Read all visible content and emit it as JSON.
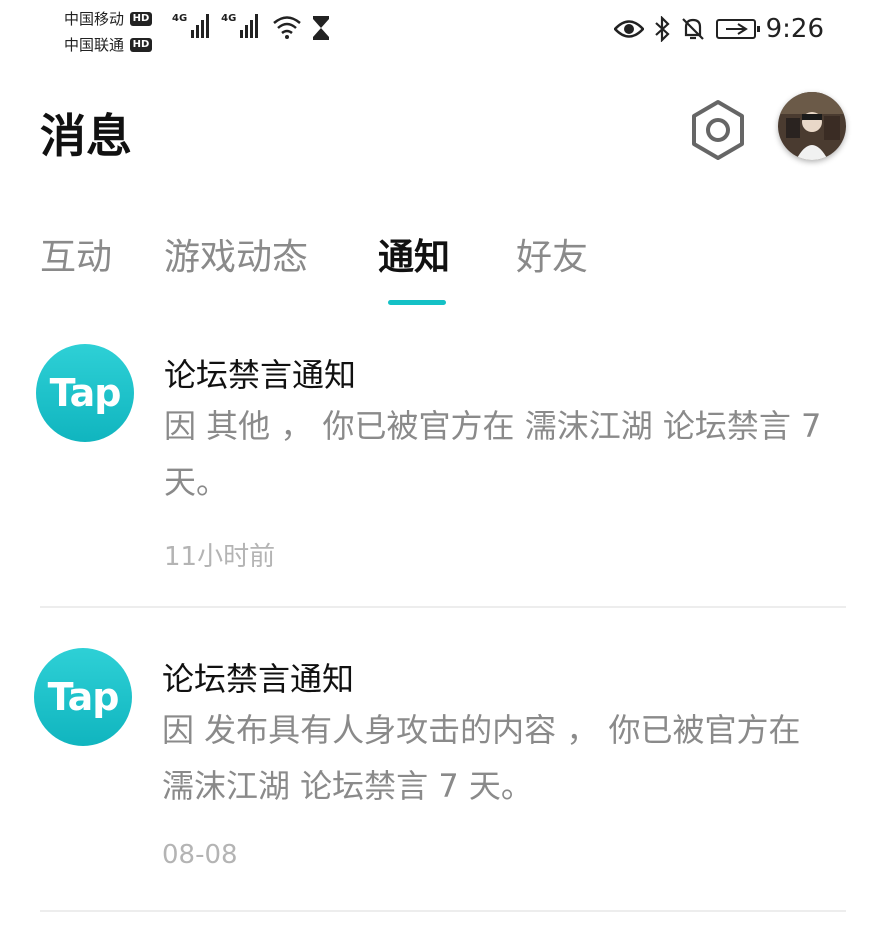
{
  "status_bar": {
    "carrier_1": "中国移动",
    "carrier_2": "中国联通",
    "hd_badge": "HD",
    "network_1": "4G",
    "network_2": "4G",
    "time": "9:26"
  },
  "header": {
    "title": "消息",
    "settings_icon": "hexagon-gear-icon",
    "avatar_icon": "user-avatar"
  },
  "tabs": [
    {
      "label": "互动",
      "active": false
    },
    {
      "label": "游戏动态",
      "active": false
    },
    {
      "label": "通知",
      "active": true
    },
    {
      "label": "好友",
      "active": false
    }
  ],
  "accent_color": "#14c1c6",
  "notifications": [
    {
      "logo": "Tap",
      "title": "论坛禁言通知",
      "body_line_1": "因 其他 ， 你已被官方在 濡沫江湖 论坛禁言 7",
      "body_line_2": "天。",
      "time": "11小时前"
    },
    {
      "logo": "Tap",
      "title": "论坛禁言通知",
      "body_line_1": "因 发布具有人身攻击的内容 ， 你已被官方在",
      "body_line_2": "濡沫江湖 论坛禁言 7 天。",
      "time": "08-08"
    }
  ]
}
